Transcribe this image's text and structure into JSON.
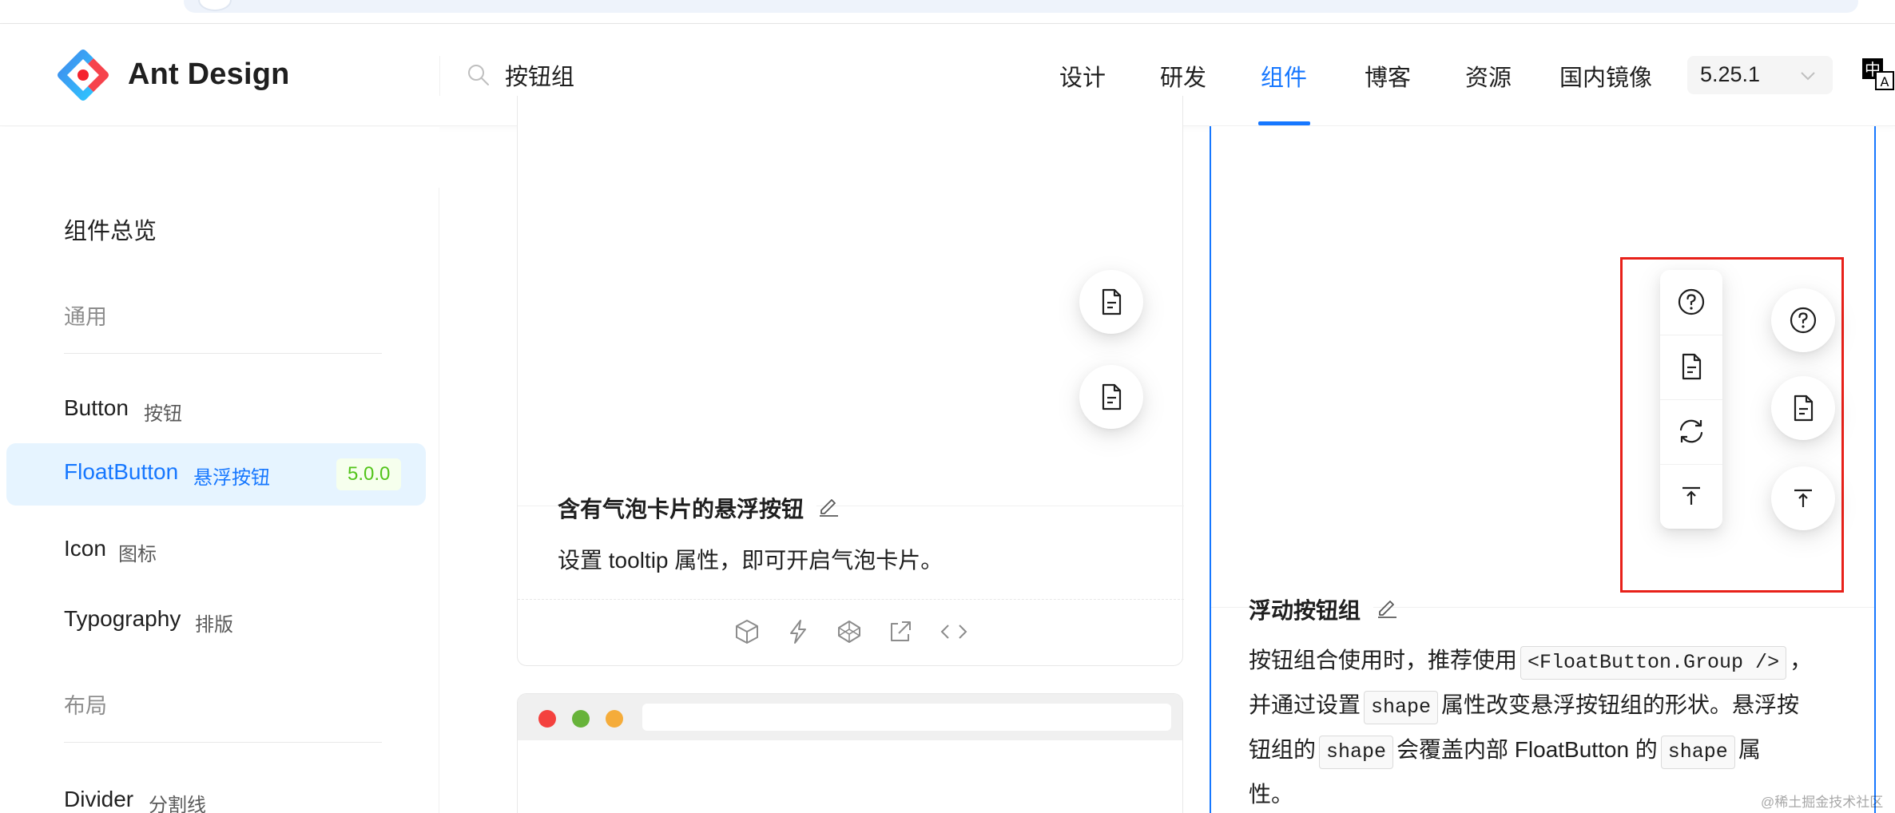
{
  "header": {
    "logo_text": "Ant Design",
    "search_value": "按钮组",
    "nav": [
      "设计",
      "研发",
      "组件",
      "博客",
      "资源",
      "国内镜像"
    ],
    "active_nav": "组件",
    "version": "5.25.1",
    "lang_icon": "language-switch-icon"
  },
  "sidebar": {
    "overview": "组件总览",
    "group_general": "通用",
    "group_layout": "布局",
    "items": [
      {
        "en": "Button",
        "zh": "按钮"
      },
      {
        "en": "FloatButton",
        "zh": "悬浮按钮",
        "badge": "5.0.0"
      },
      {
        "en": "Icon",
        "zh": "图标"
      },
      {
        "en": "Typography",
        "zh": "排版"
      },
      {
        "en": "Divider",
        "zh": "分割线"
      }
    ]
  },
  "demo_tooltip": {
    "title": "含有气泡卡片的悬浮按钮",
    "description": "设置 tooltip 属性，即可开启气泡卡片。"
  },
  "demo_group": {
    "title": "浮动按钮组",
    "line1_a": "按钮组合使用时，推荐使用",
    "code_group": "<FloatButton.Group />",
    "line1_b": "，",
    "line2_a": "并通过设置",
    "code_shape": "shape",
    "line2_b": "属性改变悬浮按钮组的形状。悬浮按",
    "line3_a": "钮组的",
    "line3_b": "会覆盖内部 FloatButton 的",
    "line3_c": "属",
    "line4": "性。"
  },
  "colors": {
    "primary": "#1677ff",
    "badge_green": "#52c41a",
    "highlight_red": "#e8211a"
  },
  "watermark": "@稀土掘金技术社区"
}
